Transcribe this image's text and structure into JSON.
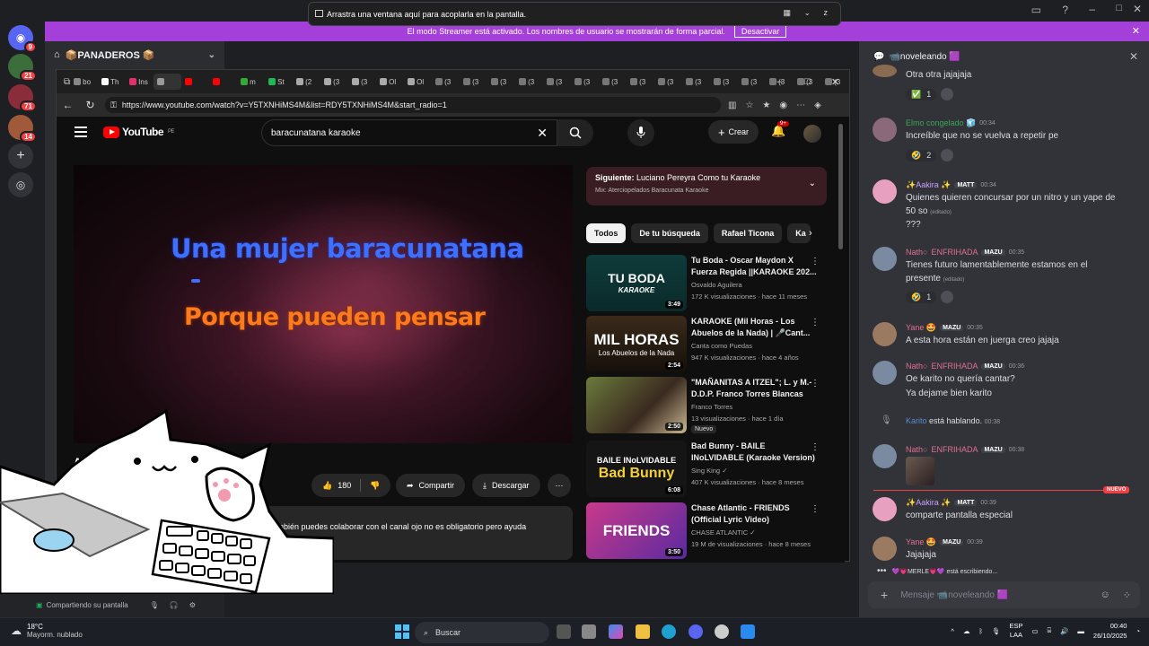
{
  "snap_tooltip": "Arrastra una ventana aquí para acoplarla en la pantalla.",
  "snap_right": "▦ ⌄ z",
  "streamer_banner": {
    "text": "El modo Streamer está activado. Los nombres de usuario se mostrarán de forma parcial.",
    "button": "Desactivar"
  },
  "server": {
    "name": "📦PANADEROS 📦",
    "badges": [
      "9",
      "21",
      "71",
      "14"
    ]
  },
  "user_strip": {
    "text": "Compartiendo su pantalla"
  },
  "browser": {
    "tabs": [
      "bo",
      "Th",
      "Ins",
      "",
      "",
      "",
      "m",
      "St",
      "(2",
      "(3",
      "(3",
      "Ol",
      "Ol",
      "(3",
      "(3",
      "(3",
      "(3",
      "(3",
      "(3",
      "(3",
      "(3",
      "(3",
      "(3",
      "(3",
      "(3",
      "(3",
      "(3",
      "(3"
    ],
    "url": "https://www.youtube.com/watch?v=Y5TXNHiMS4M&list=RDY5TXNHiMS4M&start_radio=1"
  },
  "youtube": {
    "logo": "YouTube",
    "country": "PE",
    "search_value": "baracunatana karaoke",
    "create_label": "Crear",
    "notif_count": "9+",
    "lyric_line1": "Una mujer baracunatana",
    "lyric_line2": "Porque pueden pensar",
    "title_partial": "Ato",
    "likes": "180",
    "share": "Compartir",
    "download": "Descargar",
    "description": "también puedes colaborar con el canal ojo no es obligatorio pero ayuda",
    "next": {
      "label": "Siguiente:",
      "title": "Luciano Pereyra Como tu Karaoke",
      "mix": "Mix: Aterciopelados Baracunata Karaoke"
    },
    "chips": [
      "Todos",
      "De tu búsqueda",
      "Rafael Ticona",
      "Ka"
    ],
    "videos": [
      {
        "title1": "Tu Boda - Oscar Maydon X",
        "title2": "Fuerza Regida ||KARAOKE 202...",
        "channel": "Osvaldo Aguilera",
        "meta": "172 K visualizaciones · hace 11 meses",
        "duration": "3:49",
        "thumb_text": "TU BODA",
        "thumb_sub": "KARAOKE"
      },
      {
        "title1": "KARAOKE (Mil Horas - Los",
        "title2": "Abuelos de la Nada) | 🎤Cant...",
        "channel": "Canta como Puedas",
        "meta": "947 K visualizaciones · hace 4 años",
        "duration": "2:54",
        "thumb_text": "MIL HORAS",
        "thumb_sub": "Los Abuelos de la Nada"
      },
      {
        "title1": "\"MAÑANITAS A ITZEL\"; L. y M.-",
        "title2": "D.D.P. Franco Torres Blancas",
        "channel": "Franco Torres",
        "meta": "13 visualizaciones · hace 1 día",
        "duration": "2:50",
        "badge": "Nuevo"
      },
      {
        "title1": "Bad Bunny - BAILE",
        "title2": "INoLVIDABLE (Karaoke Version)",
        "channel": "Sing King ✓",
        "meta": "407 K visualizaciones · hace 8 meses",
        "duration": "6:08",
        "thumb_text": "Bad Bunny",
        "thumb_sub": "BAILE INoLVIDABLE"
      },
      {
        "title1": "Chase Atlantic - FRIENDS",
        "title2": "(Official Lyric Video)",
        "channel": "CHASE ATLANTIC ✓",
        "meta": "19 M de visualizaciones · hace 8 meses",
        "duration": "3:50",
        "thumb_text": "FRIENDS"
      }
    ]
  },
  "chat": {
    "channel": "📹noveleando 🟪",
    "messages": [
      {
        "text": "Otra otra jajajaja",
        "react_count": "1"
      },
      {
        "name": "Elmo congelado 🧊",
        "time": "00:34",
        "text": "Increíble que no se vuelva a repetir pe",
        "react_count": "2"
      },
      {
        "name": "✨Aakira ✨",
        "tag": "MATT",
        "time": "00:34",
        "line1": "Quienes quieren concursar  por un nitro y un yape de",
        "line2": "50 so",
        "edited": "(editado)",
        "line3": "???"
      },
      {
        "name": "Nath○",
        "tag_pre": "ENFRIHADA",
        "tag": "MAZU",
        "time": "00:35",
        "line1": "Tienes futuro lamentablemente estamos en el",
        "line2": "presente",
        "edited": "(editado)",
        "react_count": "1"
      },
      {
        "name": "Yane 🤩",
        "tag": "MAZU",
        "time": "00:35",
        "text": "A esta hora están en juerga creo jajaja"
      },
      {
        "name": "Nath○",
        "tag_pre": "ENFRIHADA",
        "tag": "MAZU",
        "time": "00:36",
        "line1": "Oe karito no quería cantar?",
        "line2": "Ya dejame bien karito"
      },
      {
        "name": "Karito",
        "action": "está hablando.",
        "time": "00:38"
      },
      {
        "name": "Nath○",
        "tag_pre": "ENFRIHADA",
        "tag": "MAZU",
        "time": "00:38"
      },
      {
        "name": "✨Aakira ✨",
        "tag": "MATT",
        "time": "00:39",
        "text": "comparte pantalla especial"
      },
      {
        "name": "Yane 🤩",
        "tag": "MAZU",
        "time": "00:39",
        "text": "Jajajaja"
      }
    ],
    "new_label": "NUEVO",
    "typing": "💜💗MERLE💗💜 está escribiendo...",
    "composer_placeholder": "Mensaje 📹noveleando 🟪"
  },
  "taskbar": {
    "temp": "18°C",
    "weather": "Mayorm. nublado",
    "search": "Buscar",
    "lang1": "ESP",
    "lang2": "LAA",
    "time": "00:40",
    "date": "26/10/2025"
  }
}
